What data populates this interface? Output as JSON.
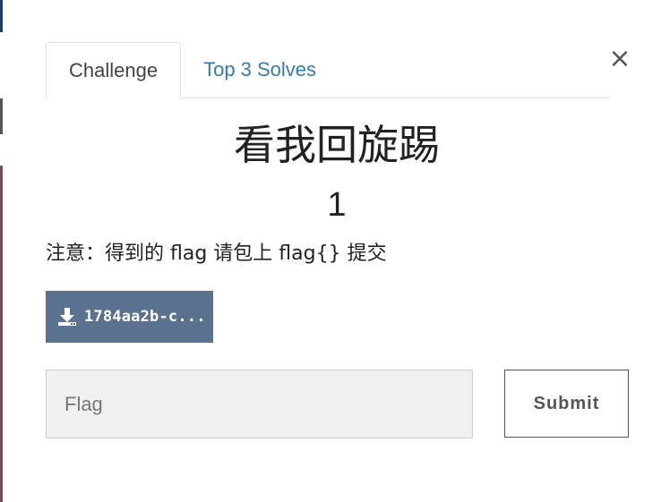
{
  "modal": {
    "close_label": "×",
    "tabs": [
      {
        "label": "Challenge"
      },
      {
        "label": "Top 3 Solves"
      }
    ],
    "challenge": {
      "title": "看我回旋踢",
      "points": "1",
      "description": "注意：得到的 flag 请包上 flag{} 提交",
      "download_label": "1784aa2b-c...",
      "flag_placeholder": "Flag",
      "flag_value": "",
      "submit_label": "Submit"
    }
  },
  "colors": {
    "download_button_bg": "#5b7190",
    "tab_link": "#337ab7",
    "input_bg": "#f0f0f0"
  },
  "icons": {
    "download": "download-icon",
    "close": "close-icon"
  }
}
